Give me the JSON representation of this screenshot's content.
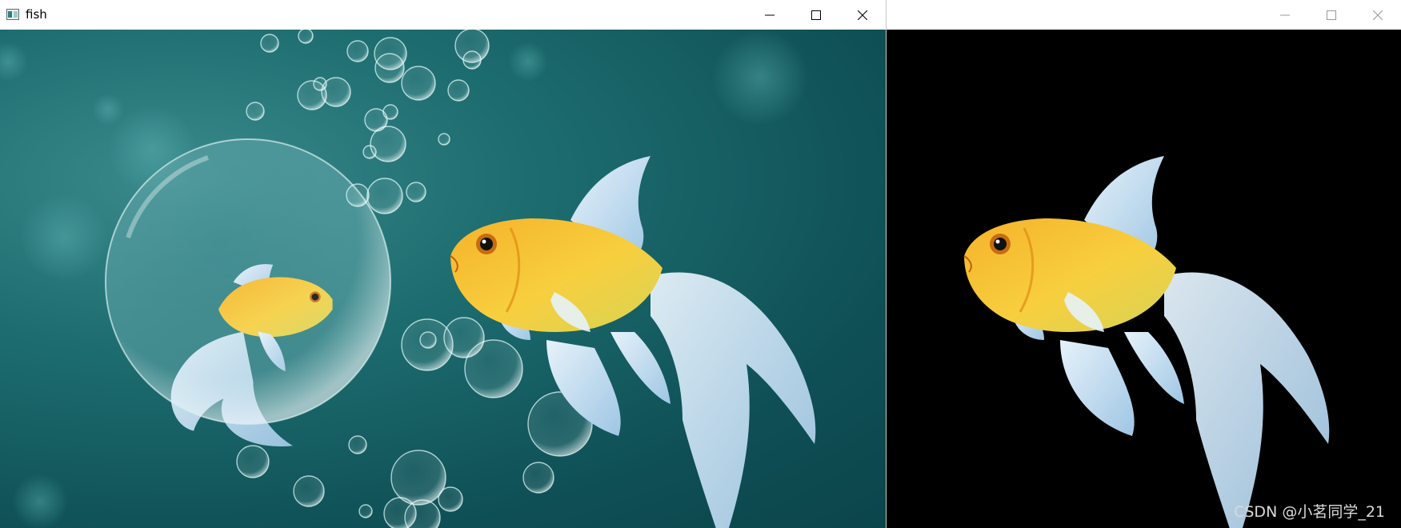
{
  "left_window": {
    "title": "fish",
    "icon": "app-window-icon",
    "controls": [
      "minimize-icon",
      "maximize-icon",
      "close-icon"
    ]
  },
  "right_window": {
    "title": "",
    "controls": [
      "minimize-icon",
      "maximize-icon",
      "close-icon"
    ],
    "watermark": "CSDN @小茗同学_21"
  },
  "colors": {
    "titlebar": "#ffffff",
    "water_dark": "#0b454b",
    "water_light": "#3a8a8c",
    "fish_orange": "#f4a21a",
    "fish_yellow": "#f7d44a",
    "fin_blue": "#bcd8ec",
    "mask_background": "#000000"
  }
}
